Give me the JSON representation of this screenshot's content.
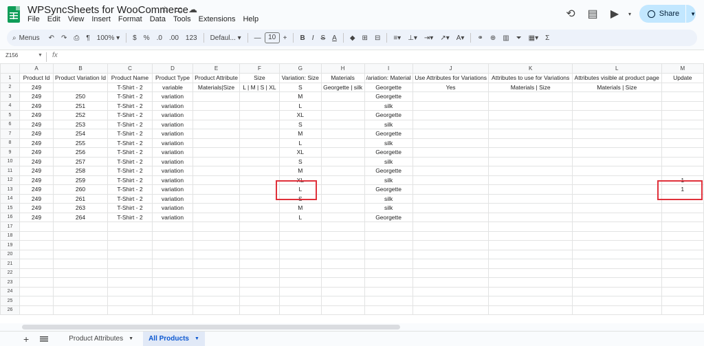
{
  "app": {
    "title": "WPSyncSheets for WooCommerce",
    "menu": [
      "File",
      "Edit",
      "View",
      "Insert",
      "Format",
      "Data",
      "Tools",
      "Extensions",
      "Help"
    ],
    "share_label": "Share"
  },
  "toolbar": {
    "menus_label": "Menus",
    "zoom": "100%",
    "currency": "$",
    "percent": "%",
    "dec_decrease": ".0",
    "dec_increase": ".00",
    "number_format": "123",
    "font": "Defaul...",
    "font_size": "10"
  },
  "formula_bar": {
    "cell_ref": "Z156",
    "fx": "fx"
  },
  "columns": [
    "A",
    "B",
    "C",
    "D",
    "E",
    "F",
    "G",
    "H",
    "I",
    "J",
    "K",
    "L",
    "M"
  ],
  "header_row": [
    "Product Id",
    "Product Variation Id",
    "Product Name",
    "Product Type",
    "Product Attribute",
    "Size",
    "Variation: Size",
    "Materials",
    "Variation: Materials",
    "Use Attributes for Variations",
    "Attributes to use for Variations",
    "Attributes visible at product page",
    "Update"
  ],
  "header_display": [
    "Product Id",
    "Product Variation Id",
    "Product Name",
    "Product Type",
    "Product Attribute",
    "Size",
    "Variation: Size",
    "Materials",
    "/ariation: Material",
    "Use Attributes for Variations",
    "Attributes to use for Variations",
    "Attributes visible at product page",
    "Update"
  ],
  "rows": [
    [
      "249",
      "",
      "T-Shirt - 2",
      "variable",
      "Materials|Size",
      "L | M | S | XL",
      "S",
      "Georgette | silk",
      "Georgette",
      "Yes",
      "Materials | Size",
      "Materials | Size",
      ""
    ],
    [
      "249",
      "250",
      "T-Shirt - 2",
      "variation",
      "",
      "",
      "M",
      "",
      "Georgette",
      "",
      "",
      "",
      ""
    ],
    [
      "249",
      "251",
      "T-Shirt - 2",
      "variation",
      "",
      "",
      "L",
      "",
      "silk",
      "",
      "",
      "",
      ""
    ],
    [
      "249",
      "252",
      "T-Shirt - 2",
      "variation",
      "",
      "",
      "XL",
      "",
      "Georgette",
      "",
      "",
      "",
      ""
    ],
    [
      "249",
      "253",
      "T-Shirt - 2",
      "variation",
      "",
      "",
      "S",
      "",
      "silk",
      "",
      "",
      "",
      ""
    ],
    [
      "249",
      "254",
      "T-Shirt - 2",
      "variation",
      "",
      "",
      "M",
      "",
      "Georgette",
      "",
      "",
      "",
      ""
    ],
    [
      "249",
      "255",
      "T-Shirt - 2",
      "variation",
      "",
      "",
      "L",
      "",
      "silk",
      "",
      "",
      "",
      ""
    ],
    [
      "249",
      "256",
      "T-Shirt - 2",
      "variation",
      "",
      "",
      "XL",
      "",
      "Georgette",
      "",
      "",
      "",
      ""
    ],
    [
      "249",
      "257",
      "T-Shirt - 2",
      "variation",
      "",
      "",
      "S",
      "",
      "silk",
      "",
      "",
      "",
      ""
    ],
    [
      "249",
      "258",
      "T-Shirt - 2",
      "variation",
      "",
      "",
      "M",
      "",
      "Georgette",
      "",
      "",
      "",
      ""
    ],
    [
      "249",
      "259",
      "T-Shirt - 2",
      "variation",
      "",
      "",
      "XL",
      "",
      "silk",
      "",
      "",
      "",
      "1"
    ],
    [
      "249",
      "260",
      "T-Shirt - 2",
      "variation",
      "",
      "",
      "L",
      "",
      "Georgette",
      "",
      "",
      "",
      "1"
    ],
    [
      "249",
      "261",
      "T-Shirt - 2",
      "variation",
      "",
      "",
      "S",
      "",
      "silk",
      "",
      "",
      "",
      ""
    ],
    [
      "249",
      "263",
      "T-Shirt - 2",
      "variation",
      "",
      "",
      "M",
      "",
      "silk",
      "",
      "",
      "",
      ""
    ],
    [
      "249",
      "264",
      "T-Shirt - 2",
      "variation",
      "",
      "",
      "L",
      "",
      "Georgette",
      "",
      "",
      "",
      ""
    ]
  ],
  "row_numbers": [
    "1",
    "2",
    "3",
    "4",
    "5",
    "6",
    "7",
    "8",
    "9",
    "10",
    "11",
    "12",
    "13",
    "14",
    "15",
    "16",
    "17",
    "18",
    "19",
    "20",
    "21",
    "22",
    "23",
    "24",
    "25",
    "26"
  ],
  "sheets": [
    {
      "label": "Product Attributes",
      "active": false
    },
    {
      "label": "All Products",
      "active": true
    }
  ],
  "colors": {
    "accent": "#0b57d0",
    "highlight": "#e0303a",
    "share_bg": "#c2e7ff",
    "sheets_green": "#0f9d58"
  }
}
